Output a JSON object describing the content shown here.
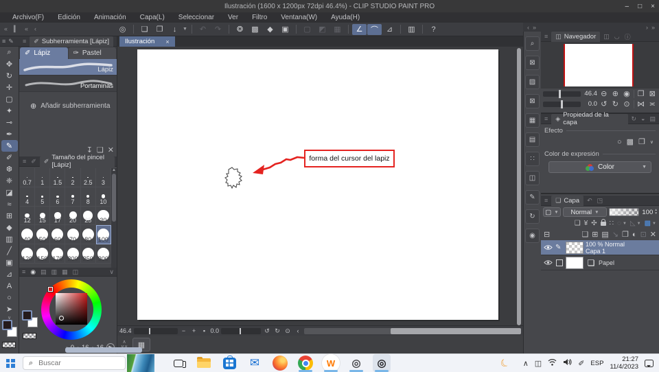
{
  "colors": {
    "accent_blue": "#6b7ca0",
    "annotation_red": "#e42320",
    "taskbar_indicator": "#79b6e8",
    "navigator_guide_red": "#c11212"
  },
  "window": {
    "title": "Ilustración (1600 x 1200px 72dpi 46.4%) - CLIP STUDIO PAINT PRO",
    "minimize": "–",
    "maximize": "□",
    "close": "×"
  },
  "menu": {
    "items": [
      "Archivo(F)",
      "Edición",
      "Animación",
      "Capa(L)",
      "Seleccionar",
      "Ver",
      "Filtro",
      "Ventana(W)",
      "Ayuda(H)"
    ]
  },
  "main_toolbar": {
    "icons": [
      {
        "name": "clip-studio-logo-button",
        "glyph": "◎"
      },
      {
        "sep": true
      },
      {
        "name": "new-canvas-button",
        "glyph": "❏"
      },
      {
        "name": "open-file-button",
        "glyph": "❐"
      },
      {
        "name": "save-file-button",
        "glyph": "↓",
        "dropdown": true
      },
      {
        "sep": true
      },
      {
        "name": "undo-button",
        "glyph": "↶",
        "state": "disabled"
      },
      {
        "name": "redo-button",
        "glyph": "↷",
        "state": "disabled"
      },
      {
        "sep": true
      },
      {
        "name": "clear-selection-button",
        "glyph": "❂"
      },
      {
        "name": "clear-outside-selection-button",
        "glyph": "▩"
      },
      {
        "name": "fill-selection-button",
        "glyph": "◆"
      },
      {
        "name": "scale-rotate-button",
        "glyph": "▣"
      },
      {
        "sep": true
      },
      {
        "name": "deselect-button",
        "glyph": "▢",
        "state": "disabled"
      },
      {
        "name": "invert-selection-button",
        "glyph": "◩",
        "state": "disabled"
      },
      {
        "name": "shrink-selection-button",
        "glyph": "▦",
        "state": "disabled"
      },
      {
        "sep": true
      },
      {
        "name": "snap-to-ruler-button",
        "glyph": "∠",
        "state": "active"
      },
      {
        "name": "snap-to-special-ruler-button",
        "glyph": "⌒",
        "state": "active"
      },
      {
        "name": "snap-to-grid-button",
        "glyph": "⊿"
      },
      {
        "sep": true
      },
      {
        "name": "open-clip-studio-button",
        "glyph": "▥"
      },
      {
        "sep": true
      },
      {
        "name": "help-button",
        "glyph": "?"
      }
    ]
  },
  "tool_palette": {
    "tools": [
      {
        "name": "zoom-tool",
        "glyph": "⌕"
      },
      {
        "name": "hand-tool",
        "glyph": "✥"
      },
      {
        "name": "rotate-canvas-tool",
        "glyph": "↻"
      },
      {
        "name": "move-tool",
        "glyph": "✛"
      },
      {
        "name": "selection-tool",
        "glyph": "▢"
      },
      {
        "name": "auto-select-tool",
        "glyph": "✦"
      },
      {
        "name": "eyedropper-tool",
        "glyph": "⊸"
      },
      {
        "name": "pen-tool",
        "glyph": "✒"
      },
      {
        "name": "pencil-tool",
        "glyph": "✎",
        "selected": true
      },
      {
        "name": "brush-tool",
        "glyph": "✐"
      },
      {
        "name": "airbrush-tool",
        "glyph": "❆"
      },
      {
        "name": "decoration-tool",
        "glyph": "❈"
      },
      {
        "name": "eraser-tool",
        "glyph": "◪"
      },
      {
        "name": "blend-tool",
        "glyph": "≈"
      },
      {
        "name": "figure-tool",
        "glyph": "⊞"
      },
      {
        "name": "fill-tool",
        "glyph": "◆"
      },
      {
        "name": "gradient-tool",
        "glyph": "▥"
      },
      {
        "name": "line-tool",
        "glyph": "╱"
      },
      {
        "name": "frame-border-tool",
        "glyph": "▣"
      },
      {
        "name": "polyline-tool",
        "glyph": "⊿"
      },
      {
        "name": "text-tool",
        "glyph": "A"
      },
      {
        "name": "balloon-tool",
        "glyph": "○"
      },
      {
        "name": "object-tool",
        "glyph": "➤"
      }
    ]
  },
  "subtool_panel": {
    "header": "Subherramienta [Lápiz]",
    "tabs": [
      {
        "label": "Lápiz",
        "selected": true
      },
      {
        "label": "Pastel",
        "selected": false
      }
    ],
    "brushes": [
      {
        "label": "Lápiz",
        "selected": true
      },
      {
        "label": "Portaminas",
        "selected": false
      }
    ],
    "add_label": "Añadir subherramienta",
    "footer_icons": [
      {
        "name": "import-subtool-button",
        "glyph": "↧"
      },
      {
        "name": "duplicate-subtool-button",
        "glyph": "❏"
      },
      {
        "name": "delete-subtool-button",
        "glyph": "✕"
      }
    ]
  },
  "brush_size_panel": {
    "header": "Tamaño del pincel [Lápiz]",
    "selected": "100",
    "sizes": [
      "0.7",
      "1",
      "1.5",
      "2",
      "2.5",
      "3",
      "4",
      "5",
      "6",
      "7",
      "8",
      "10",
      "12",
      "15",
      "17",
      "20",
      "25",
      "30",
      "40",
      "50",
      "60",
      "70",
      "80",
      "100",
      "120",
      "150",
      "170",
      "200",
      "250",
      "300"
    ]
  },
  "color_panel": {
    "hue": "0",
    "saturation": "16",
    "value": "16"
  },
  "canvas": {
    "tab_label": "Ilustración",
    "tab_close": "×",
    "annotation_text": "forma del cursor del lapiz",
    "zoom_value": "46.4",
    "rotation_value": "0.0"
  },
  "dock_strip": {
    "icons": [
      {
        "name": "dock-quick-access-button",
        "glyph": "⌕"
      },
      {
        "name": "dock-material-1-button",
        "glyph": "⊠"
      },
      {
        "name": "dock-material-2-button",
        "glyph": "▨"
      },
      {
        "name": "dock-material-3-button",
        "glyph": "⊠"
      },
      {
        "name": "dock-material-4-button",
        "glyph": "▦"
      },
      {
        "name": "dock-material-5-button",
        "glyph": "▤"
      },
      {
        "name": "dock-material-6-button",
        "glyph": "∷"
      },
      {
        "name": "dock-material-7-button",
        "glyph": "◫"
      },
      {
        "name": "dock-material-8-button",
        "glyph": "✎"
      },
      {
        "name": "dock-material-9-button",
        "glyph": "↻"
      },
      {
        "name": "dock-material-10-button",
        "glyph": "◉"
      }
    ]
  },
  "navigator": {
    "tab_label": "Navegador",
    "zoom_value": "46.4",
    "rotation_value": "0.0"
  },
  "layer_property": {
    "tab_label": "Propiedad de la capa",
    "effect_label": "Efecto",
    "expression_label": "Color de expresión",
    "expression_value": "Color"
  },
  "layer_panel": {
    "tab_label": "Capa",
    "blend_mode": "Normal",
    "opacity_value": "100",
    "layers": [
      {
        "info": "100 % Normal",
        "name": "Capa 1",
        "selected": true
      },
      {
        "name": "Papel",
        "selected": false
      }
    ]
  },
  "taskbar": {
    "search_placeholder": "Buscar",
    "language": "ESP",
    "time": "21:27",
    "date": "11/4/2023",
    "apps": [
      {
        "name": "task-view-button"
      },
      {
        "name": "file-explorer-button"
      },
      {
        "name": "microsoft-store-button"
      },
      {
        "name": "mail-button",
        "glyph": "✉"
      },
      {
        "name": "firefox-button"
      },
      {
        "name": "chrome-button",
        "open": true
      },
      {
        "name": "wattpad-button",
        "glyph": "W",
        "open": true
      },
      {
        "name": "clip-studio-button",
        "glyph": "◎",
        "open": true
      },
      {
        "name": "clip-studio-paint-button",
        "glyph": "◎",
        "open": true,
        "active": true
      }
    ],
    "tray": [
      {
        "name": "moon-icon",
        "glyph": "☾"
      },
      {
        "name": "chevron-up-icon",
        "glyph": "∧"
      },
      {
        "name": "teams-icon",
        "glyph": "◫"
      },
      {
        "name": "wifi-icon",
        "glyph": "svg-wifi"
      },
      {
        "name": "volume-icon",
        "glyph": "svg-volume"
      },
      {
        "name": "pen-icon",
        "glyph": "✐"
      }
    ]
  }
}
